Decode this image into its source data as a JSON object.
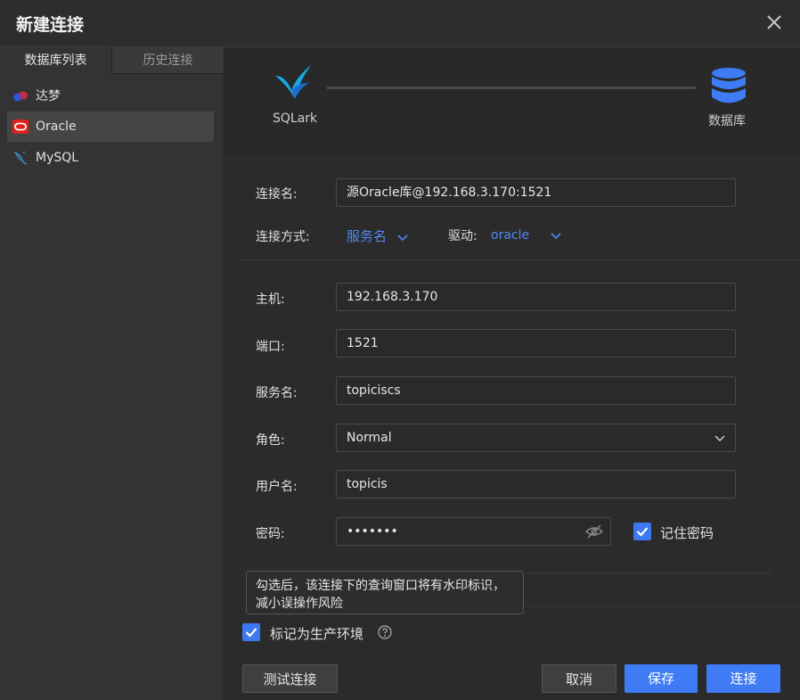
{
  "dialog": {
    "title": "新建连接"
  },
  "sidebar": {
    "tabs": [
      {
        "label": "数据库列表"
      },
      {
        "label": "历史连接"
      }
    ],
    "items": [
      {
        "label": "达梦",
        "icon": "dameng-icon"
      },
      {
        "label": "Oracle",
        "icon": "oracle-icon"
      },
      {
        "label": "MySQL",
        "icon": "mysql-icon"
      }
    ]
  },
  "stepper": {
    "source_label": "SQLark",
    "target_label": "数据库"
  },
  "form": {
    "conn_name_label": "连接名:",
    "conn_name_value": "源Oracle库@192.168.3.170:1521",
    "conn_method_label": "连接方式:",
    "conn_method_value": "服务名",
    "driver_label": "驱动:",
    "driver_value": "oracle",
    "host_label": "主机:",
    "host_value": "192.168.3.170",
    "port_label": "端口:",
    "port_value": "1521",
    "service_label": "服务名:",
    "service_value": "topiciscs",
    "role_label": "角色:",
    "role_value": "Normal",
    "user_label": "用户名:",
    "user_value": "topicis",
    "password_label": "密码:",
    "password_value": "•••••••",
    "remember_label": "记住密码",
    "prod_label": "标记为生产环境",
    "tooltip": "勾选后，该连接下的查询窗口将有水印标识，减小误操作风险"
  },
  "buttons": {
    "test": "测试连接",
    "cancel": "取消",
    "save": "保存",
    "connect": "连接"
  },
  "colors": {
    "accent": "#3e7bf5",
    "link": "#4f8af7",
    "oracle_red": "#e0201b"
  }
}
